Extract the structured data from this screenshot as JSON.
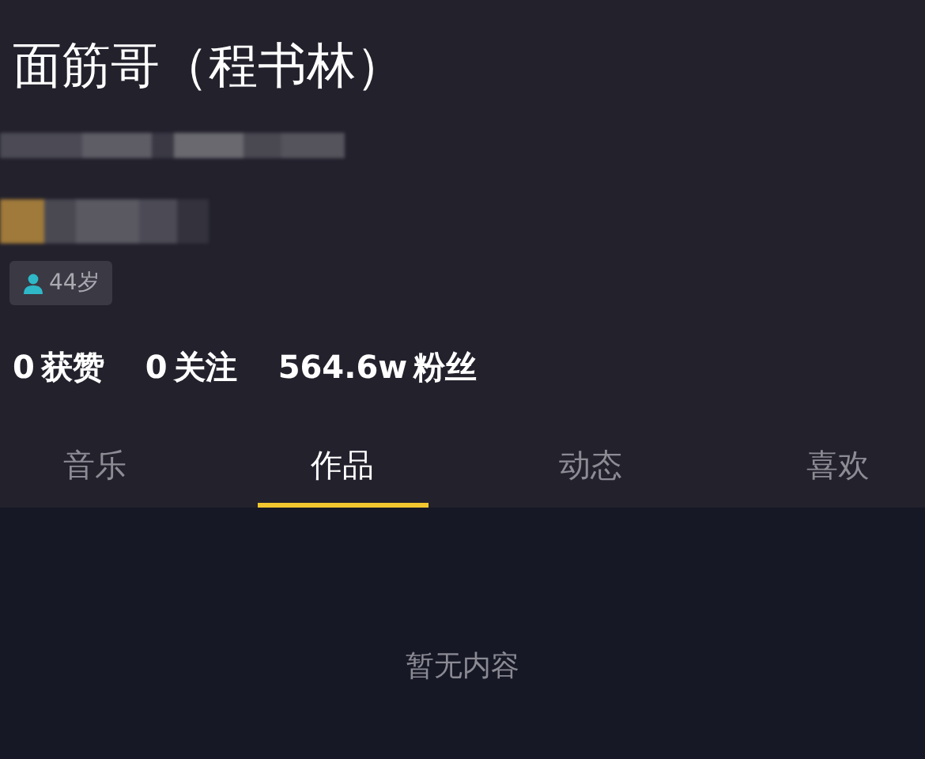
{
  "profile": {
    "name": "面筋哥（程书林）",
    "age_badge": "44岁"
  },
  "stats": [
    {
      "count": "0",
      "label": "获赞"
    },
    {
      "count": "0",
      "label": "关注"
    },
    {
      "count": "564.6w",
      "label": "粉丝"
    }
  ],
  "tabs": [
    {
      "label": "音乐",
      "selected": false
    },
    {
      "label": "作品",
      "selected": true
    },
    {
      "label": "动态",
      "selected": false
    },
    {
      "label": "喜欢",
      "selected": false
    }
  ],
  "content": {
    "empty_message": "暂无内容"
  }
}
